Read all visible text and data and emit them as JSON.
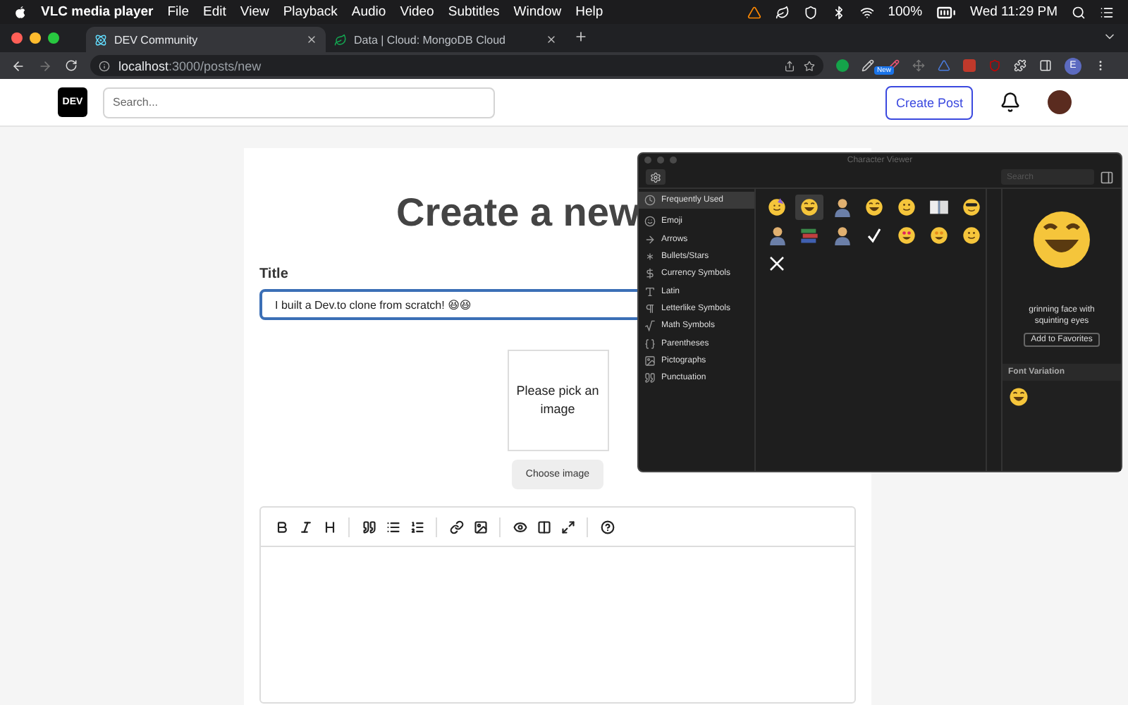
{
  "menubar": {
    "app": "VLC media player",
    "menus": [
      "File",
      "Edit",
      "View",
      "Playback",
      "Audio",
      "Video",
      "Subtitles",
      "Window",
      "Help"
    ],
    "battery": "100%",
    "clock": "Wed 11:29 PM"
  },
  "tabs": [
    {
      "title": "DEV Community",
      "selected": true
    },
    {
      "title": "Data | Cloud: MongoDB Cloud",
      "selected": false
    }
  ],
  "address": {
    "host": "localhost",
    "path": ":3000/posts/new"
  },
  "extension_badge": "New",
  "profile_letter": "E",
  "site": {
    "logo": "DEV",
    "search_placeholder": "Search...",
    "create_button": "Create Post"
  },
  "editor": {
    "heading": "Create a new",
    "title_label": "Title",
    "title_value": "I built a Dev.to clone from scratch! 😆😆",
    "image_placeholder": "Please pick an image",
    "choose_button": "Choose image",
    "toolbar": [
      [
        {
          "kind": "bold"
        },
        {
          "kind": "italic"
        },
        {
          "kind": "heading"
        }
      ],
      [
        {
          "kind": "quote"
        },
        {
          "kind": "list"
        },
        {
          "kind": "ordered-list"
        }
      ],
      [
        {
          "kind": "link"
        },
        {
          "kind": "image"
        }
      ],
      [
        {
          "kind": "preview"
        },
        {
          "kind": "side-by-side"
        },
        {
          "kind": "fullscreen"
        }
      ],
      [
        {
          "kind": "help"
        }
      ]
    ]
  },
  "character_viewer": {
    "title": "Character Viewer",
    "search_placeholder": "Search",
    "categories": [
      {
        "label": "Frequently Used",
        "kind": "clock",
        "selected": true
      },
      {
        "label": "Emoji",
        "kind": "smile",
        "selected": false
      },
      {
        "label": "Arrows",
        "kind": "arrow",
        "selected": false
      },
      {
        "label": "Bullets/Stars",
        "kind": "asterisk",
        "selected": false
      },
      {
        "label": "Currency Symbols",
        "kind": "dollar",
        "selected": false
      },
      {
        "label": "Latin",
        "kind": "letter",
        "selected": false
      },
      {
        "label": "Letterlike Symbols",
        "kind": "pilcrow",
        "selected": false
      },
      {
        "label": "Math Symbols",
        "kind": "radical",
        "selected": false
      },
      {
        "label": "Parentheses",
        "kind": "parens",
        "selected": false
      },
      {
        "label": "Pictographs",
        "kind": "picto",
        "selected": false
      },
      {
        "label": "Punctuation",
        "kind": "punct",
        "selected": false
      }
    ],
    "characters": [
      {
        "kind": "party-face",
        "selected": false
      },
      {
        "kind": "grin-face",
        "selected": true
      },
      {
        "kind": "person",
        "selected": false
      },
      {
        "kind": "grin-face",
        "selected": false
      },
      {
        "kind": "smile-face",
        "selected": false
      },
      {
        "kind": "book",
        "selected": false
      },
      {
        "kind": "cool-face",
        "selected": false
      },
      {
        "kind": "person",
        "selected": false
      },
      {
        "kind": "books",
        "selected": false
      },
      {
        "kind": "person",
        "selected": false
      },
      {
        "kind": "check",
        "selected": false
      },
      {
        "kind": "heart-face",
        "selected": false
      },
      {
        "kind": "star-face",
        "selected": false
      },
      {
        "kind": "smile-face",
        "selected": false
      },
      {
        "kind": "cross",
        "selected": false
      }
    ],
    "preview_name": "grinning face with squinting eyes",
    "favorites_button": "Add to Favorites",
    "font_variation_label": "Font Variation"
  }
}
